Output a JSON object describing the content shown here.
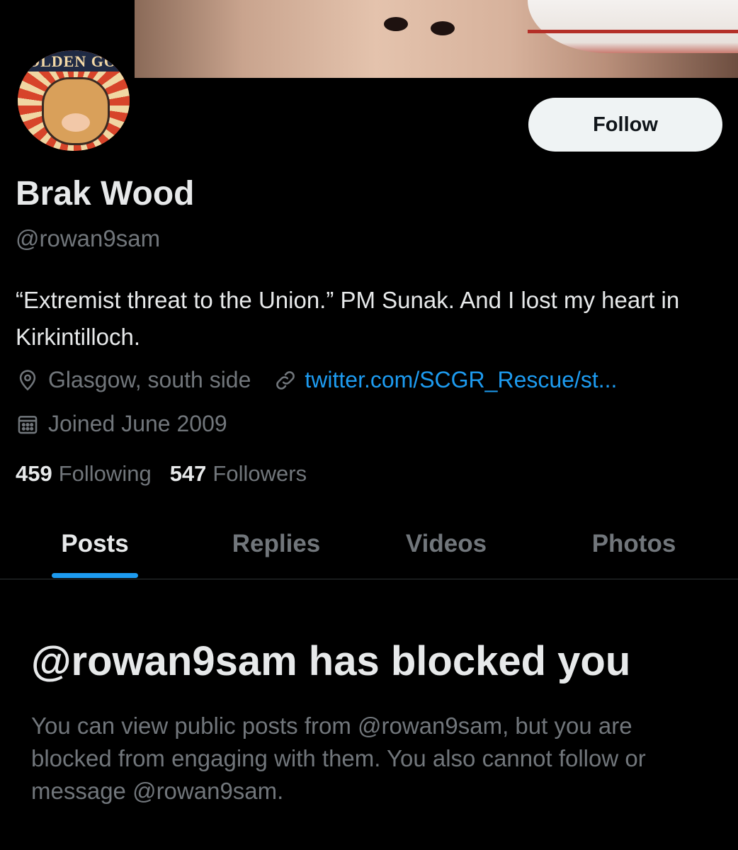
{
  "profile": {
    "display_name": "Brak Wood",
    "handle": "@rowan9sam",
    "bio": "“Extremist threat to the Union.” PM Sunak. And I lost my heart in Kirkintilloch.",
    "location": "Glasgow, south side",
    "website": "twitter.com/SCGR_Rescue/st...",
    "joined": "Joined June 2009",
    "avatar_text": "OLDEN GO",
    "following_count": "459",
    "following_label": "Following",
    "followers_count": "547",
    "followers_label": "Followers"
  },
  "actions": {
    "follow_label": "Follow"
  },
  "tabs": [
    {
      "label": "Posts",
      "active": true
    },
    {
      "label": "Replies",
      "active": false
    },
    {
      "label": "Videos",
      "active": false
    },
    {
      "label": "Photos",
      "active": false
    }
  ],
  "blocked": {
    "title": "@rowan9sam has blocked you",
    "message": "You can view public posts from @rowan9sam, but you are blocked from engaging with them. You also cannot follow or message @rowan9sam."
  },
  "icons": {
    "location": "location-pin-icon",
    "link": "link-icon",
    "calendar": "calendar-icon"
  },
  "colors": {
    "background": "#000000",
    "accent": "#1d9bf0",
    "text_primary": "#e7e9ea",
    "text_secondary": "#71767b",
    "button_bg": "#eff3f4"
  }
}
